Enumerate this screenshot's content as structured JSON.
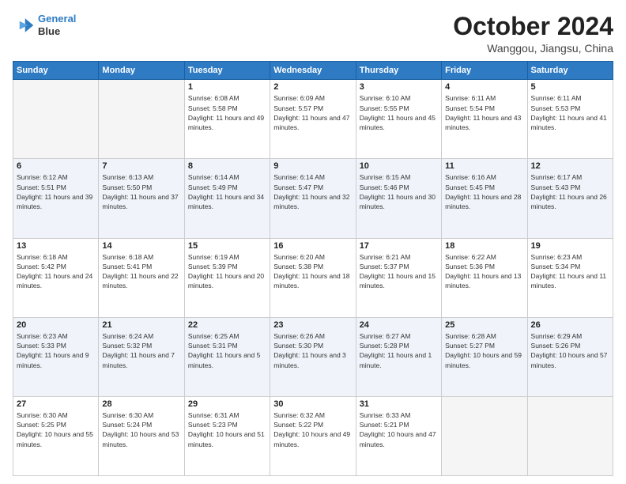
{
  "header": {
    "logo_line1": "General",
    "logo_line2": "Blue",
    "month": "October 2024",
    "location": "Wanggou, Jiangsu, China"
  },
  "weekdays": [
    "Sunday",
    "Monday",
    "Tuesday",
    "Wednesday",
    "Thursday",
    "Friday",
    "Saturday"
  ],
  "weeks": [
    [
      {
        "day": "",
        "sunrise": "",
        "sunset": "",
        "daylight": ""
      },
      {
        "day": "",
        "sunrise": "",
        "sunset": "",
        "daylight": ""
      },
      {
        "day": "1",
        "sunrise": "Sunrise: 6:08 AM",
        "sunset": "Sunset: 5:58 PM",
        "daylight": "Daylight: 11 hours and 49 minutes."
      },
      {
        "day": "2",
        "sunrise": "Sunrise: 6:09 AM",
        "sunset": "Sunset: 5:57 PM",
        "daylight": "Daylight: 11 hours and 47 minutes."
      },
      {
        "day": "3",
        "sunrise": "Sunrise: 6:10 AM",
        "sunset": "Sunset: 5:55 PM",
        "daylight": "Daylight: 11 hours and 45 minutes."
      },
      {
        "day": "4",
        "sunrise": "Sunrise: 6:11 AM",
        "sunset": "Sunset: 5:54 PM",
        "daylight": "Daylight: 11 hours and 43 minutes."
      },
      {
        "day": "5",
        "sunrise": "Sunrise: 6:11 AM",
        "sunset": "Sunset: 5:53 PM",
        "daylight": "Daylight: 11 hours and 41 minutes."
      }
    ],
    [
      {
        "day": "6",
        "sunrise": "Sunrise: 6:12 AM",
        "sunset": "Sunset: 5:51 PM",
        "daylight": "Daylight: 11 hours and 39 minutes."
      },
      {
        "day": "7",
        "sunrise": "Sunrise: 6:13 AM",
        "sunset": "Sunset: 5:50 PM",
        "daylight": "Daylight: 11 hours and 37 minutes."
      },
      {
        "day": "8",
        "sunrise": "Sunrise: 6:14 AM",
        "sunset": "Sunset: 5:49 PM",
        "daylight": "Daylight: 11 hours and 34 minutes."
      },
      {
        "day": "9",
        "sunrise": "Sunrise: 6:14 AM",
        "sunset": "Sunset: 5:47 PM",
        "daylight": "Daylight: 11 hours and 32 minutes."
      },
      {
        "day": "10",
        "sunrise": "Sunrise: 6:15 AM",
        "sunset": "Sunset: 5:46 PM",
        "daylight": "Daylight: 11 hours and 30 minutes."
      },
      {
        "day": "11",
        "sunrise": "Sunrise: 6:16 AM",
        "sunset": "Sunset: 5:45 PM",
        "daylight": "Daylight: 11 hours and 28 minutes."
      },
      {
        "day": "12",
        "sunrise": "Sunrise: 6:17 AM",
        "sunset": "Sunset: 5:43 PM",
        "daylight": "Daylight: 11 hours and 26 minutes."
      }
    ],
    [
      {
        "day": "13",
        "sunrise": "Sunrise: 6:18 AM",
        "sunset": "Sunset: 5:42 PM",
        "daylight": "Daylight: 11 hours and 24 minutes."
      },
      {
        "day": "14",
        "sunrise": "Sunrise: 6:18 AM",
        "sunset": "Sunset: 5:41 PM",
        "daylight": "Daylight: 11 hours and 22 minutes."
      },
      {
        "day": "15",
        "sunrise": "Sunrise: 6:19 AM",
        "sunset": "Sunset: 5:39 PM",
        "daylight": "Daylight: 11 hours and 20 minutes."
      },
      {
        "day": "16",
        "sunrise": "Sunrise: 6:20 AM",
        "sunset": "Sunset: 5:38 PM",
        "daylight": "Daylight: 11 hours and 18 minutes."
      },
      {
        "day": "17",
        "sunrise": "Sunrise: 6:21 AM",
        "sunset": "Sunset: 5:37 PM",
        "daylight": "Daylight: 11 hours and 15 minutes."
      },
      {
        "day": "18",
        "sunrise": "Sunrise: 6:22 AM",
        "sunset": "Sunset: 5:36 PM",
        "daylight": "Daylight: 11 hours and 13 minutes."
      },
      {
        "day": "19",
        "sunrise": "Sunrise: 6:23 AM",
        "sunset": "Sunset: 5:34 PM",
        "daylight": "Daylight: 11 hours and 11 minutes."
      }
    ],
    [
      {
        "day": "20",
        "sunrise": "Sunrise: 6:23 AM",
        "sunset": "Sunset: 5:33 PM",
        "daylight": "Daylight: 11 hours and 9 minutes."
      },
      {
        "day": "21",
        "sunrise": "Sunrise: 6:24 AM",
        "sunset": "Sunset: 5:32 PM",
        "daylight": "Daylight: 11 hours and 7 minutes."
      },
      {
        "day": "22",
        "sunrise": "Sunrise: 6:25 AM",
        "sunset": "Sunset: 5:31 PM",
        "daylight": "Daylight: 11 hours and 5 minutes."
      },
      {
        "day": "23",
        "sunrise": "Sunrise: 6:26 AM",
        "sunset": "Sunset: 5:30 PM",
        "daylight": "Daylight: 11 hours and 3 minutes."
      },
      {
        "day": "24",
        "sunrise": "Sunrise: 6:27 AM",
        "sunset": "Sunset: 5:28 PM",
        "daylight": "Daylight: 11 hours and 1 minute."
      },
      {
        "day": "25",
        "sunrise": "Sunrise: 6:28 AM",
        "sunset": "Sunset: 5:27 PM",
        "daylight": "Daylight: 10 hours and 59 minutes."
      },
      {
        "day": "26",
        "sunrise": "Sunrise: 6:29 AM",
        "sunset": "Sunset: 5:26 PM",
        "daylight": "Daylight: 10 hours and 57 minutes."
      }
    ],
    [
      {
        "day": "27",
        "sunrise": "Sunrise: 6:30 AM",
        "sunset": "Sunset: 5:25 PM",
        "daylight": "Daylight: 10 hours and 55 minutes."
      },
      {
        "day": "28",
        "sunrise": "Sunrise: 6:30 AM",
        "sunset": "Sunset: 5:24 PM",
        "daylight": "Daylight: 10 hours and 53 minutes."
      },
      {
        "day": "29",
        "sunrise": "Sunrise: 6:31 AM",
        "sunset": "Sunset: 5:23 PM",
        "daylight": "Daylight: 10 hours and 51 minutes."
      },
      {
        "day": "30",
        "sunrise": "Sunrise: 6:32 AM",
        "sunset": "Sunset: 5:22 PM",
        "daylight": "Daylight: 10 hours and 49 minutes."
      },
      {
        "day": "31",
        "sunrise": "Sunrise: 6:33 AM",
        "sunset": "Sunset: 5:21 PM",
        "daylight": "Daylight: 10 hours and 47 minutes."
      },
      {
        "day": "",
        "sunrise": "",
        "sunset": "",
        "daylight": ""
      },
      {
        "day": "",
        "sunrise": "",
        "sunset": "",
        "daylight": ""
      }
    ]
  ]
}
